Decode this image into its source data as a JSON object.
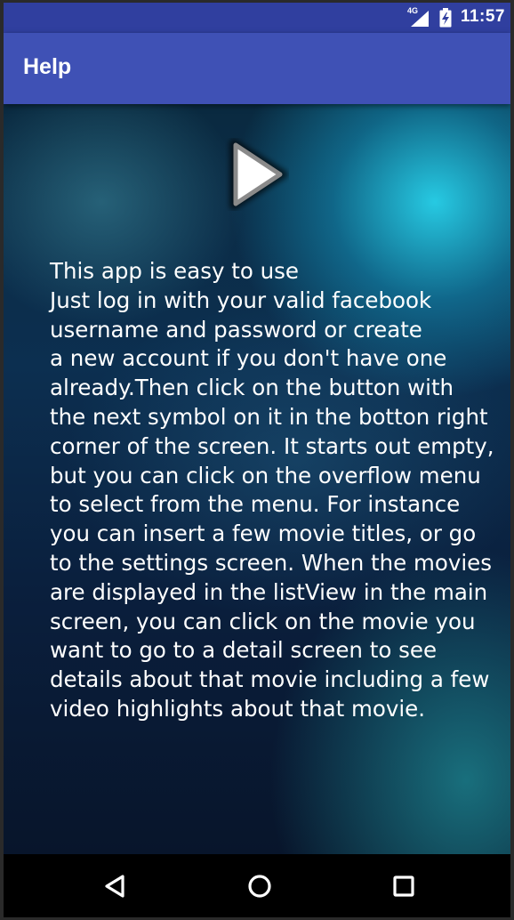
{
  "status_bar": {
    "network_label": "4G",
    "time": "11:57"
  },
  "app_bar": {
    "title": "Help"
  },
  "content": {
    "play_icon": "play-icon",
    "help_lines": [
      "This app is easy to use",
      "Just log in with your valid facebook",
      "username and password or create",
      "a new account if you don't have one",
      "already.Then click on the button with",
      "the next symbol on it in the botton right",
      "corner of the screen. It starts out empty,",
      "but you can click on the overflow menu",
      "to select from the menu. For instance",
      "you can insert a few movie titles, or go",
      "to the settings screen. When the movies",
      "are displayed in the listView in the main",
      "screen, you can click on the movie you",
      "want to go to a detail screen to see",
      "details about that movie including a few",
      "video highlights about that movie."
    ]
  },
  "nav_bar": {
    "back_icon": "back-triangle-icon",
    "home_icon": "home-circle-icon",
    "recents_icon": "recents-square-icon"
  },
  "colors": {
    "status_bar": "#303f9f",
    "app_bar": "#3f51b5",
    "text": "#ffffff"
  }
}
